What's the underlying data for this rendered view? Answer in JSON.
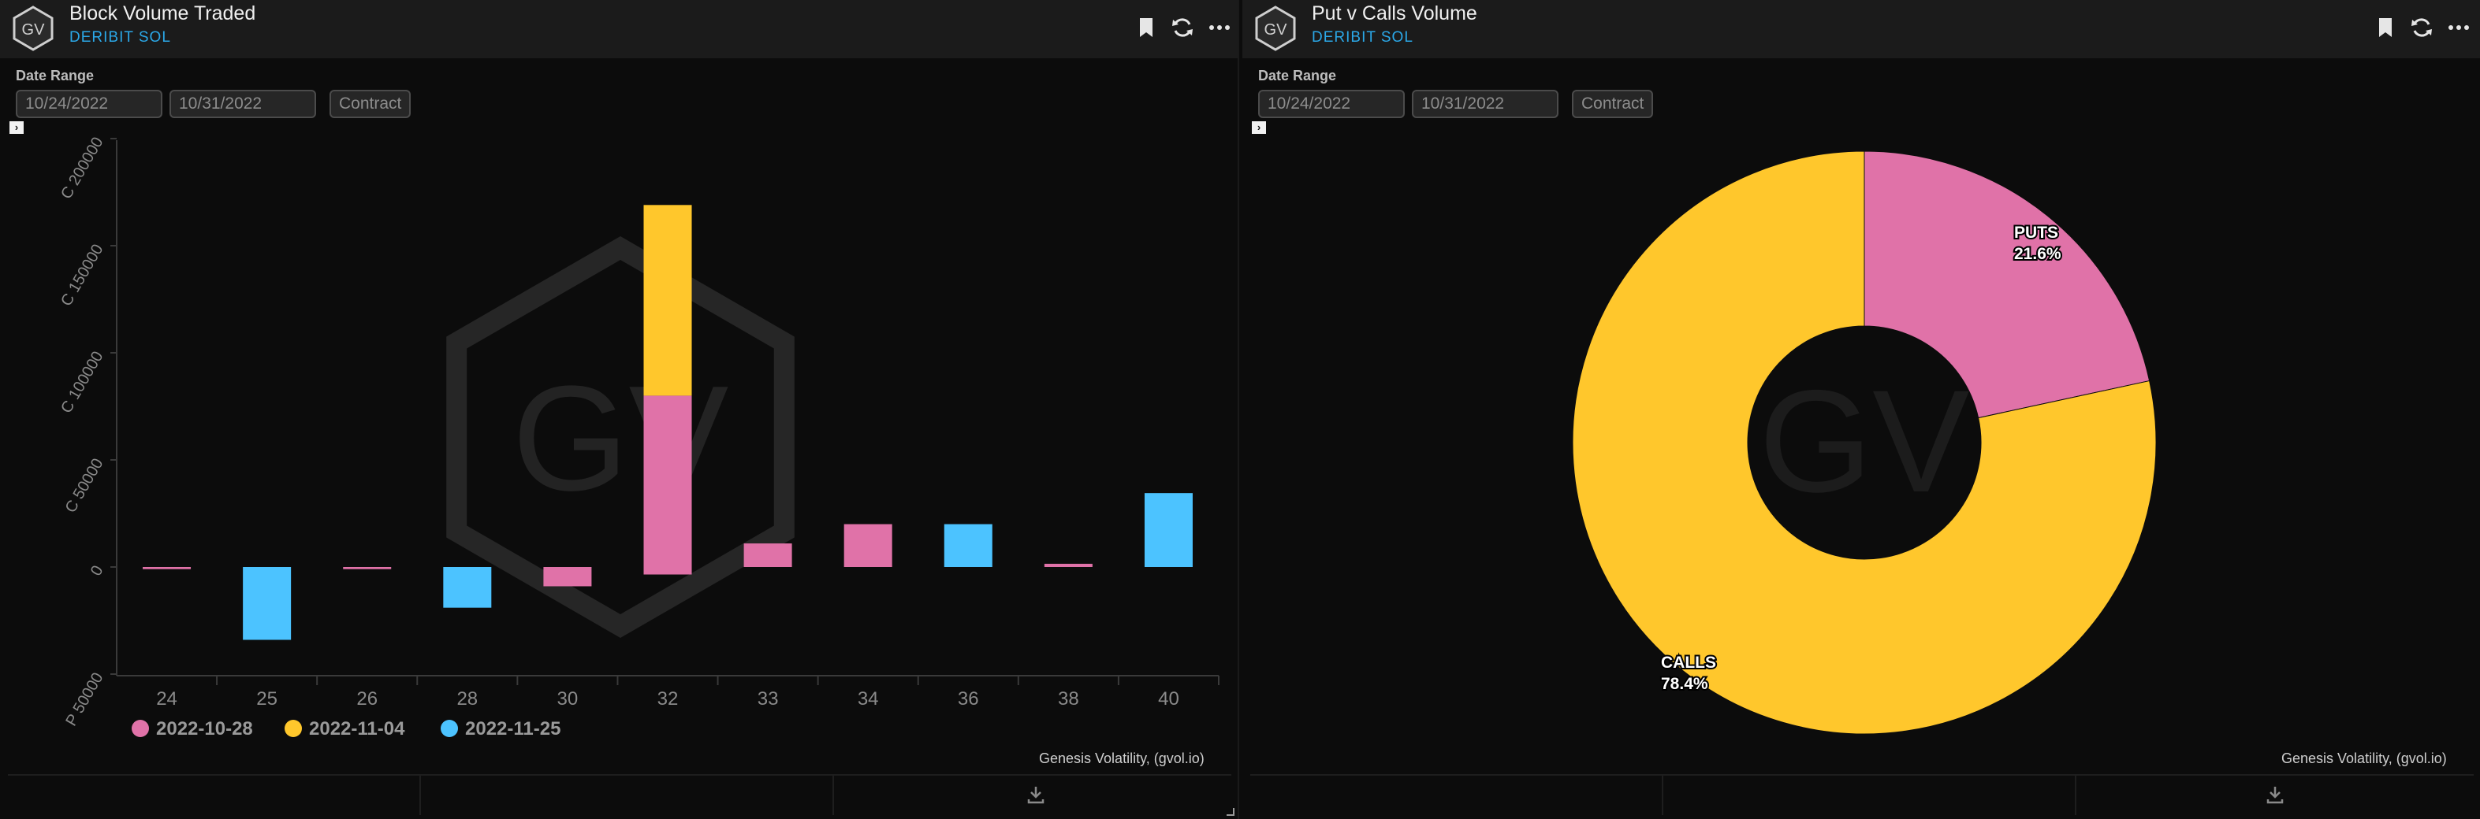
{
  "colors": {
    "pink": "#e072a8",
    "yellow": "#ffc72c",
    "blue": "#4cc3ff",
    "accent": "#2ba8e8"
  },
  "panels": [
    {
      "title": "Block Volume Traded",
      "subtitle": "DERIBIT SOL",
      "date_range_label": "Date Range",
      "date_from": "10/24/2022",
      "date_to": "10/31/2022",
      "contract_label": "Contract",
      "credit": "Genesis Volatility, (gvol.io)",
      "icons": [
        "bookmark-icon",
        "refresh-icon",
        "more-icon",
        "download-icon"
      ]
    },
    {
      "title": "Put v Calls Volume",
      "subtitle": "DERIBIT SOL",
      "date_range_label": "Date Range",
      "date_from": "10/24/2022",
      "date_to": "10/31/2022",
      "contract_label": "Contract",
      "credit": "Genesis Volatility, (gvol.io)",
      "icons": [
        "bookmark-icon",
        "refresh-icon",
        "more-icon",
        "download-icon"
      ]
    }
  ],
  "watermark": "GV",
  "logo_text": "GV",
  "chart_data": [
    {
      "type": "bar",
      "stacked": true,
      "categories": [
        "24",
        "25",
        "26",
        "28",
        "30",
        "32",
        "33",
        "34",
        "36",
        "38",
        "40"
      ],
      "y_tick_labels": [
        "P 50000",
        "0",
        "C 50000",
        "C 100000",
        "C 150000",
        "C 200000"
      ],
      "ylim": [
        -50000,
        200000
      ],
      "series": [
        {
          "name": "2022-10-28",
          "color": "#e072a8",
          "values": [
            -1000,
            0,
            -1000,
            0,
            -9000,
            80000,
            11000,
            20000,
            0,
            1500,
            0
          ],
          "values_put_extra_32": -3500
        },
        {
          "name": "2022-11-04",
          "color": "#ffc72c",
          "values": [
            0,
            0,
            0,
            0,
            0,
            89000,
            0,
            0,
            0,
            0,
            0
          ]
        },
        {
          "name": "2022-11-25",
          "color": "#4cc3ff",
          "values": [
            0,
            -34000,
            0,
            -19000,
            0,
            0,
            0,
            0,
            20000,
            0,
            34500
          ]
        }
      ],
      "legend_position": "bottom-left",
      "grid": false
    },
    {
      "type": "pie",
      "donut": true,
      "slices": [
        {
          "label": "PUTS",
          "value": 21.6,
          "display": "21.6%",
          "color": "#e072a8"
        },
        {
          "label": "CALLS",
          "value": 78.4,
          "display": "78.4%",
          "color": "#ffc72c"
        }
      ]
    }
  ]
}
